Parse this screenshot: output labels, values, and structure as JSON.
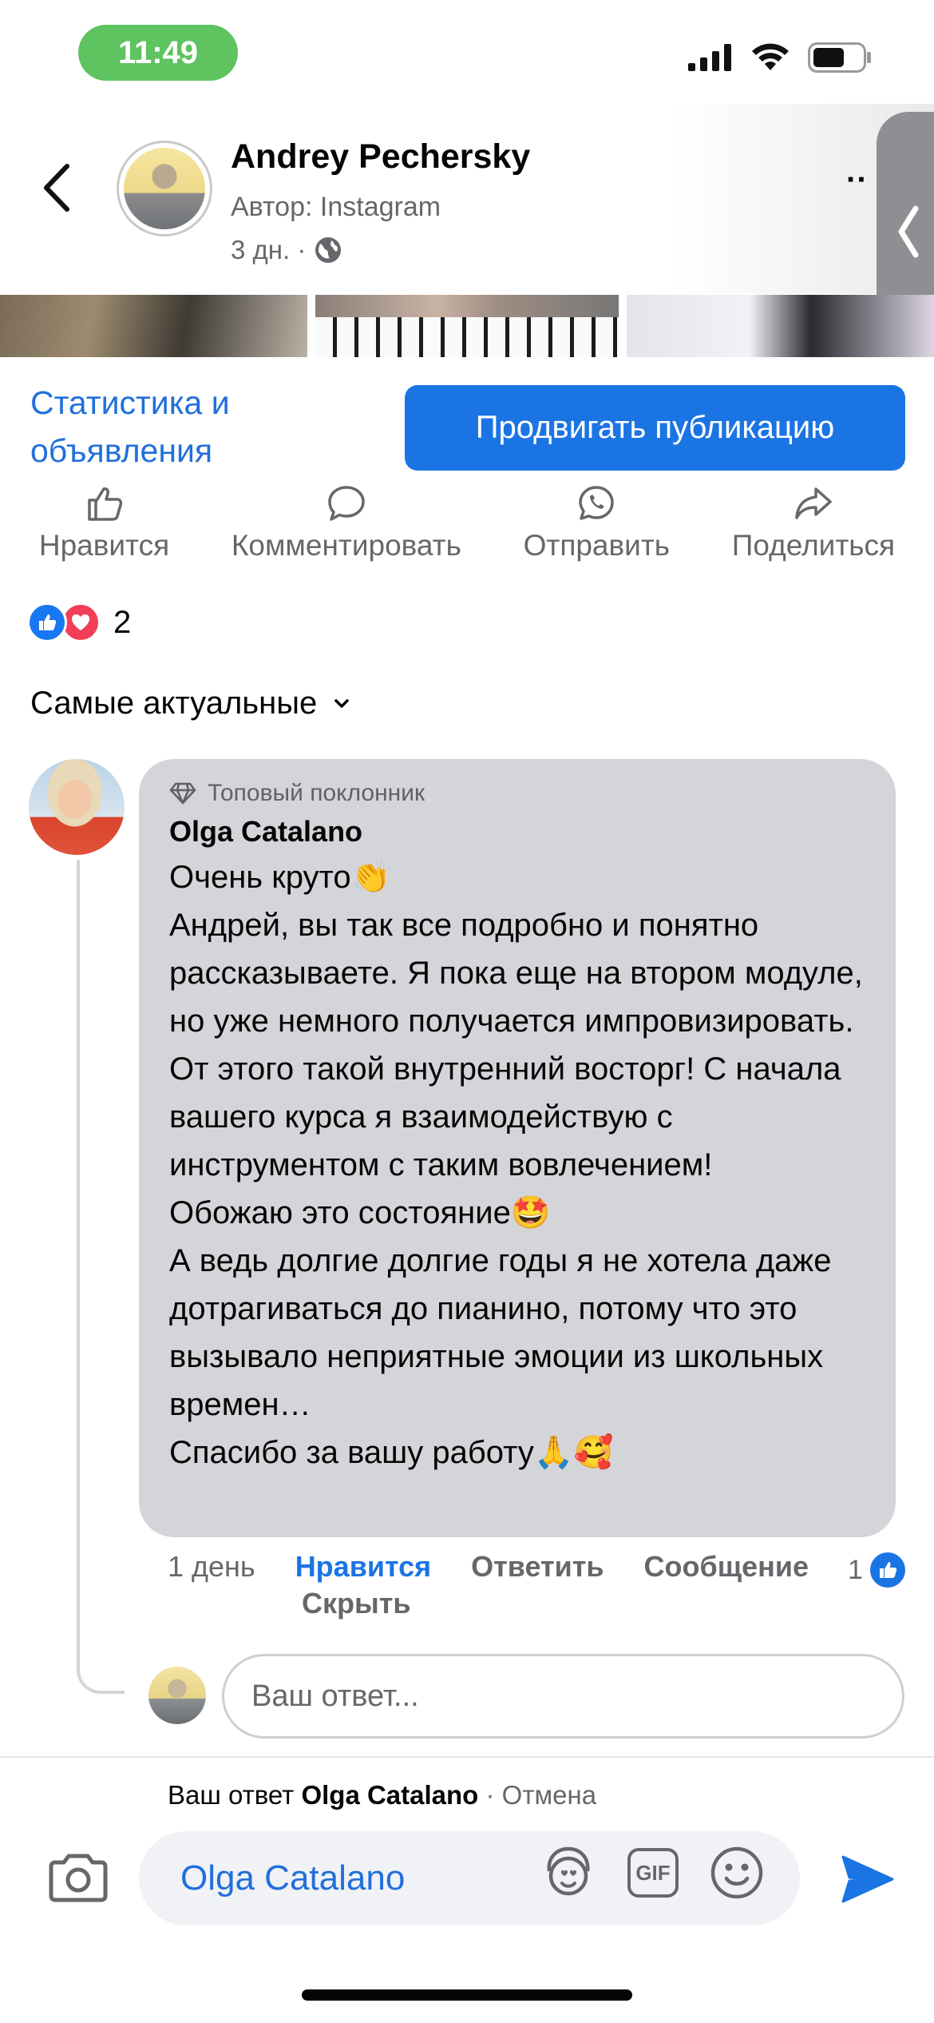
{
  "status_bar": {
    "time": "11:49"
  },
  "post": {
    "author_name": "Andrey Pechersky",
    "source": "Автор: Instagram",
    "age": "3 дн. ·",
    "stats_link": "Статистика и объявления",
    "promote_label": "Продвигать публикацию"
  },
  "actions": {
    "like": "Нравится",
    "comment": "Комментировать",
    "send": "Отправить",
    "share": "Поделиться"
  },
  "reactions": {
    "count": "2"
  },
  "sort": {
    "label": "Самые актуальные"
  },
  "comment": {
    "badge": "Топовый поклонник",
    "author": "Olga Catalano",
    "text": "Очень круто👏\nАндрей, вы так все подробно и понятно рассказываете. Я пока еще на втором модуле, но уже немного получается импровизировать. От этого такой внутренний восторг! С начала вашего курса я взаимодействую с инструментом с таким вовлечением!\nОбожаю это состояние🤩\nА ведь долгие долгие годы я не хотела даже дотрагиваться до пианино, потому что это вызывало неприятные эмоции из школьных времен…\nСпасибо за вашу работу🙏🥰",
    "time": "1 день",
    "like_label": "Нравится",
    "reply_label": "Ответить",
    "message_label": "Сообщение",
    "hide_label": "Скрыть",
    "like_count": "1"
  },
  "reply_box": {
    "placeholder": "Ваш ответ..."
  },
  "composer": {
    "reply_prefix": "Ваш ответ",
    "reply_name": "Olga Catalano",
    "cancel": "· Отмена",
    "mention": "Olga Catalano",
    "gif_label": "GIF"
  },
  "colors": {
    "accent": "#1b74e4",
    "link": "#216fdb",
    "love": "#f33e58",
    "bubble": "#d4d5d9"
  }
}
